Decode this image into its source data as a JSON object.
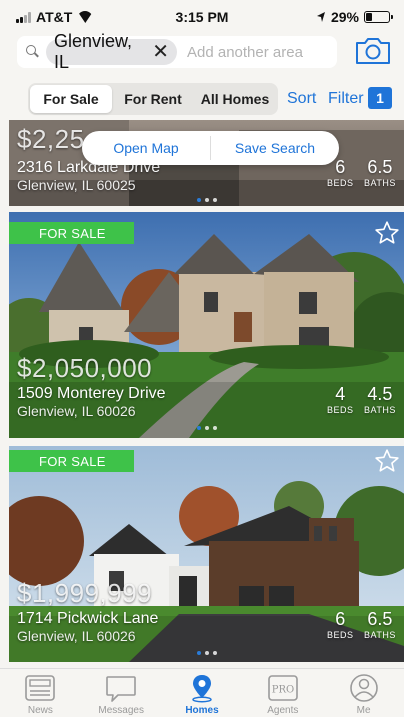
{
  "status_bar": {
    "carrier": "AT&T",
    "time": "3:15 PM",
    "battery": "29%"
  },
  "search": {
    "chip_label": "Glenview, IL",
    "placeholder": "Add another area"
  },
  "filters": {
    "tabs": [
      {
        "label": "For Sale",
        "active": true
      },
      {
        "label": "For Rent",
        "active": false
      },
      {
        "label": "All Homes",
        "active": false
      }
    ],
    "sort_label": "Sort",
    "filter_label": "Filter",
    "filter_count": "1"
  },
  "popover": {
    "open_map": "Open Map",
    "save_search": "Save Search"
  },
  "listings": [
    {
      "price": "$2,25",
      "address": "2316 Larkdale Drive",
      "city": "Glenview, IL 60025",
      "beds": "6",
      "baths": "6.5",
      "beds_label": "BEDS",
      "baths_label": "BATHS"
    },
    {
      "badge": "FOR SALE",
      "price": "$2,050,000",
      "address": "1509 Monterey Drive",
      "city": "Glenview, IL 60026",
      "beds": "4",
      "baths": "4.5",
      "beds_label": "BEDS",
      "baths_label": "BATHS"
    },
    {
      "badge": "FOR SALE",
      "price": "$1,999,999",
      "address": "1714 Pickwick Lane",
      "city": "Glenview, IL 60026",
      "beds": "6",
      "baths": "6.5",
      "beds_label": "BEDS",
      "baths_label": "BATHS"
    }
  ],
  "tab_bar": [
    {
      "label": "News",
      "icon": "news-icon",
      "active": false
    },
    {
      "label": "Messages",
      "icon": "messages-icon",
      "active": false
    },
    {
      "label": "Homes",
      "icon": "homes-icon",
      "active": true
    },
    {
      "label": "Agents",
      "icon": "agents-icon",
      "badge_text": "PRO",
      "active": false
    },
    {
      "label": "Me",
      "icon": "me-icon",
      "active": false
    }
  ],
  "colors": {
    "accent": "#1f74d8",
    "for_sale_green": "#3ec249"
  }
}
